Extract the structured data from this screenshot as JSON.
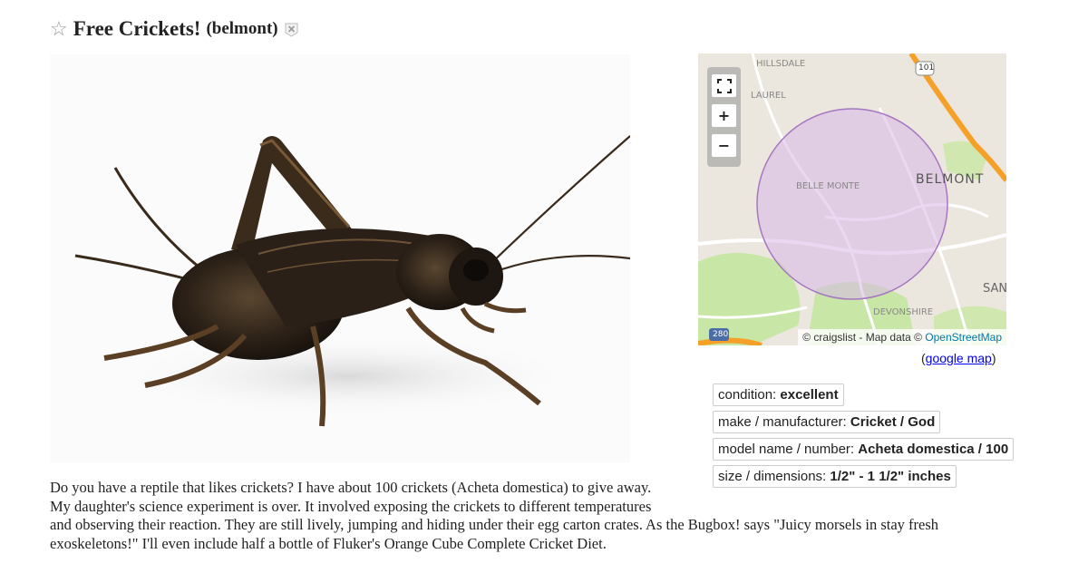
{
  "post": {
    "title": "Free Crickets!",
    "location": "(belmont)"
  },
  "icons": {
    "favorite": "star-icon",
    "hide": "hide-x-icon"
  },
  "map": {
    "labels": {
      "hillsdale": "HILLSDALE",
      "laurel": "LAUREL",
      "belle_monte": "BELLE MONTE",
      "belmont": "BELMONT",
      "san": "SAN",
      "devonshire": "DEVONSHIRE",
      "hwy101": "101",
      "hwy280": "280"
    },
    "attribution_prefix": "© craigslist - Map data © ",
    "attribution_link": "OpenStreetMap",
    "google_map_open": "(",
    "google_map_link": "google map",
    "google_map_close": ")",
    "colors": {
      "land": "#ece7de",
      "park": "#c8e6a6",
      "highway": "#f5a028",
      "radius_fill": "#d8b8e8",
      "radius_stroke": "#a676c2"
    }
  },
  "attributes": [
    {
      "label": "condition: ",
      "value": "excellent"
    },
    {
      "label": "make / manufacturer: ",
      "value": "Cricket / God"
    },
    {
      "label": "model name / number: ",
      "value": "Acheta domestica / 100"
    },
    {
      "label": "size / dimensions: ",
      "value": "1/2\" - 1 1/2\" inches"
    }
  ],
  "body": {
    "line1": "Do you have a reptile that likes crickets? I have about 100 crickets (Acheta domestica) to give away.",
    "line2": "My daughter's science experiment is over. It involved exposing the crickets to different temperatures",
    "line3": "and observing their reaction. They are still lively, jumping and hiding under their egg carton crates. As the Bugbox! says \"Juicy morsels in stay fresh",
    "line4": "exoskeletons!\" I'll even include half a bottle of Fluker's Orange Cube Complete Cricket Diet."
  }
}
